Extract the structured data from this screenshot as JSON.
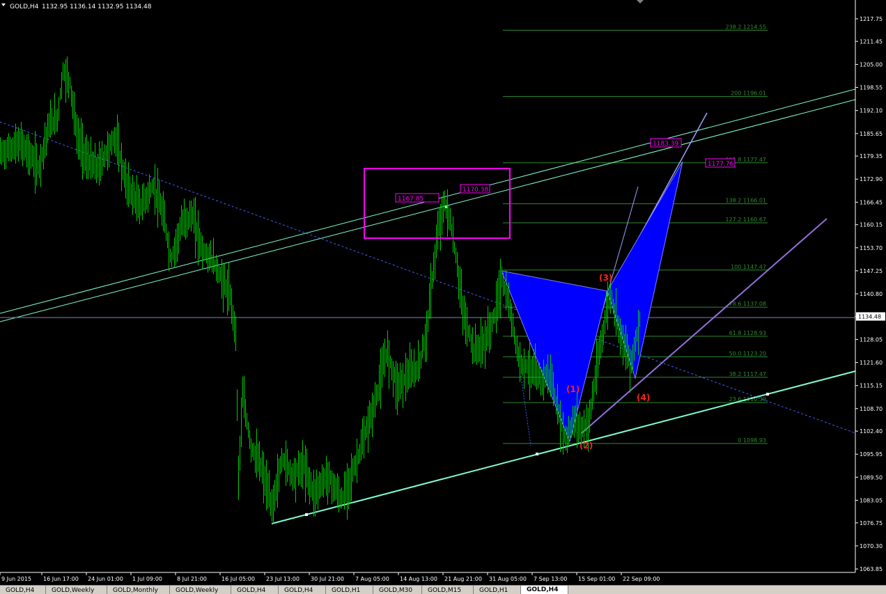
{
  "header": {
    "symbol_label": "GOLD,H4",
    "ohlc": "1132.95 1136.14 1132.95 1134.48"
  },
  "tabs": [
    {
      "label": "GOLD,H4"
    },
    {
      "label": "GOLD,Weekly"
    },
    {
      "label": "GOLD,Monthly"
    },
    {
      "label": "GOLD,Weekly"
    },
    {
      "label": "GOLD,H4"
    },
    {
      "label": "GOLD,H4"
    },
    {
      "label": "GOLD,H1"
    },
    {
      "label": "GOLD,M30"
    },
    {
      "label": "GOLD,M15"
    },
    {
      "label": "GOLD,H1"
    },
    {
      "label": "GOLD,H4",
      "active": true
    }
  ],
  "colors": {
    "background": "#000000",
    "candle": "#00cc00",
    "channel": "#7fffd4",
    "fib": "#2e8b2e",
    "pattern": "#0000ff",
    "box": "#ff00ff",
    "label_red": "#ff2020",
    "trend_purple": "#9370db"
  },
  "chart_data": {
    "type": "candlestick",
    "symbol": "GOLD",
    "timeframe": "H4",
    "ylim": [
      1063.85,
      1222.5
    ],
    "current_price": 1134.48,
    "price_ticks": [
      "1217.75",
      "1211.45",
      "1205.00",
      "1198.55",
      "1192.10",
      "1185.65",
      "1179.35",
      "1172.90",
      "1166.45",
      "1160.15",
      "1153.70",
      "1147.25",
      "1140.80",
      "1134.48",
      "1128.05",
      "1121.60",
      "1115.15",
      "1108.70",
      "1102.40",
      "1095.95",
      "1089.50",
      "1083.05",
      "1076.75",
      "1070.30",
      "1063.85"
    ],
    "time_ticks": [
      "9 Jun 2015",
      "16 Jun 17:00",
      "24 Jun 01:00",
      "1 Jul 09:00",
      "8 Jul 21:00",
      "16 Jul 05:00",
      "23 Jul 13:00",
      "30 Jul 21:00",
      "7 Aug 05:00",
      "14 Aug 13:00",
      "21 Aug 21:00",
      "31 Aug 05:00",
      "7 Sep 13:00",
      "15 Sep 01:00",
      "22 Sep 09:00"
    ],
    "price_path": [
      [
        0,
        1180
      ],
      [
        30,
        1183
      ],
      [
        55,
        1176
      ],
      [
        70,
        1188
      ],
      [
        82,
        1190
      ],
      [
        90,
        1203
      ],
      [
        100,
        1200
      ],
      [
        110,
        1185
      ],
      [
        125,
        1178
      ],
      [
        140,
        1176
      ],
      [
        165,
        1185
      ],
      [
        180,
        1172
      ],
      [
        200,
        1165
      ],
      [
        220,
        1171
      ],
      [
        235,
        1162
      ],
      [
        245,
        1150
      ],
      [
        260,
        1160
      ],
      [
        275,
        1163
      ],
      [
        290,
        1153
      ],
      [
        305,
        1150
      ],
      [
        318,
        1145
      ],
      [
        330,
        1140
      ],
      [
        338,
        1130
      ],
      [
        342,
        1090
      ],
      [
        348,
        1112
      ],
      [
        360,
        1098
      ],
      [
        375,
        1092
      ],
      [
        390,
        1081
      ],
      [
        405,
        1095
      ],
      [
        420,
        1090
      ],
      [
        435,
        1093
      ],
      [
        450,
        1085
      ],
      [
        470,
        1090
      ],
      [
        490,
        1083
      ],
      [
        510,
        1093
      ],
      [
        525,
        1102
      ],
      [
        540,
        1112
      ],
      [
        555,
        1125
      ],
      [
        570,
        1115
      ],
      [
        585,
        1118
      ],
      [
        600,
        1120
      ],
      [
        612,
        1130
      ],
      [
        620,
        1145
      ],
      [
        630,
        1160
      ],
      [
        638,
        1166
      ],
      [
        645,
        1162
      ],
      [
        655,
        1150
      ],
      [
        665,
        1135
      ],
      [
        680,
        1125
      ],
      [
        695,
        1127
      ],
      [
        710,
        1135
      ],
      [
        720,
        1145
      ],
      [
        730,
        1138
      ],
      [
        745,
        1122
      ],
      [
        760,
        1120
      ],
      [
        775,
        1117
      ],
      [
        790,
        1118
      ],
      [
        800,
        1108
      ],
      [
        812,
        1100
      ],
      [
        825,
        1106
      ],
      [
        835,
        1103
      ],
      [
        845,
        1105
      ],
      [
        855,
        1118
      ],
      [
        865,
        1130
      ],
      [
        875,
        1141
      ],
      [
        885,
        1134
      ],
      [
        895,
        1127
      ],
      [
        905,
        1121
      ],
      [
        915,
        1130
      ],
      [
        918,
        1134.5
      ]
    ],
    "fibonacci": [
      {
        "label": "238.2 1214.55",
        "price": 1214.55
      },
      {
        "label": "200 1196.01",
        "price": 1196.01
      },
      {
        "label": "161.8 1177.47",
        "price": 1177.47
      },
      {
        "label": "138.2 1166.01",
        "price": 1166.01
      },
      {
        "label": "127.2 1160.67",
        "price": 1160.67
      },
      {
        "label": "100 1147.47",
        "price": 1147.47
      },
      {
        "label": "78.6 1137.08",
        "price": 1137.08
      },
      {
        "label": "61.8 1128.93",
        "price": 1128.93
      },
      {
        "label": "50.0 1123.20",
        "price": 1123.2
      },
      {
        "label": "38.2 1117.47",
        "price": 1117.47
      },
      {
        "label": "23.6 1110.39",
        "price": 1110.39
      },
      {
        "label": "0 1098.93",
        "price": 1098.93
      }
    ],
    "price_labels": [
      {
        "text": "1167.85",
        "price": 1167.85
      },
      {
        "text": "1170.38",
        "price": 1170.38
      },
      {
        "text": "1183.39",
        "price": 1183.39
      },
      {
        "text": "1177.76",
        "price": 1177.76
      }
    ],
    "wave_labels": [
      {
        "text": "(1)",
        "price": 1115.0
      },
      {
        "text": "(2)",
        "price": 1099.0
      },
      {
        "text": "(3)",
        "price": 1145.0
      },
      {
        "text": "(4)",
        "price": 1113.0
      }
    ]
  }
}
